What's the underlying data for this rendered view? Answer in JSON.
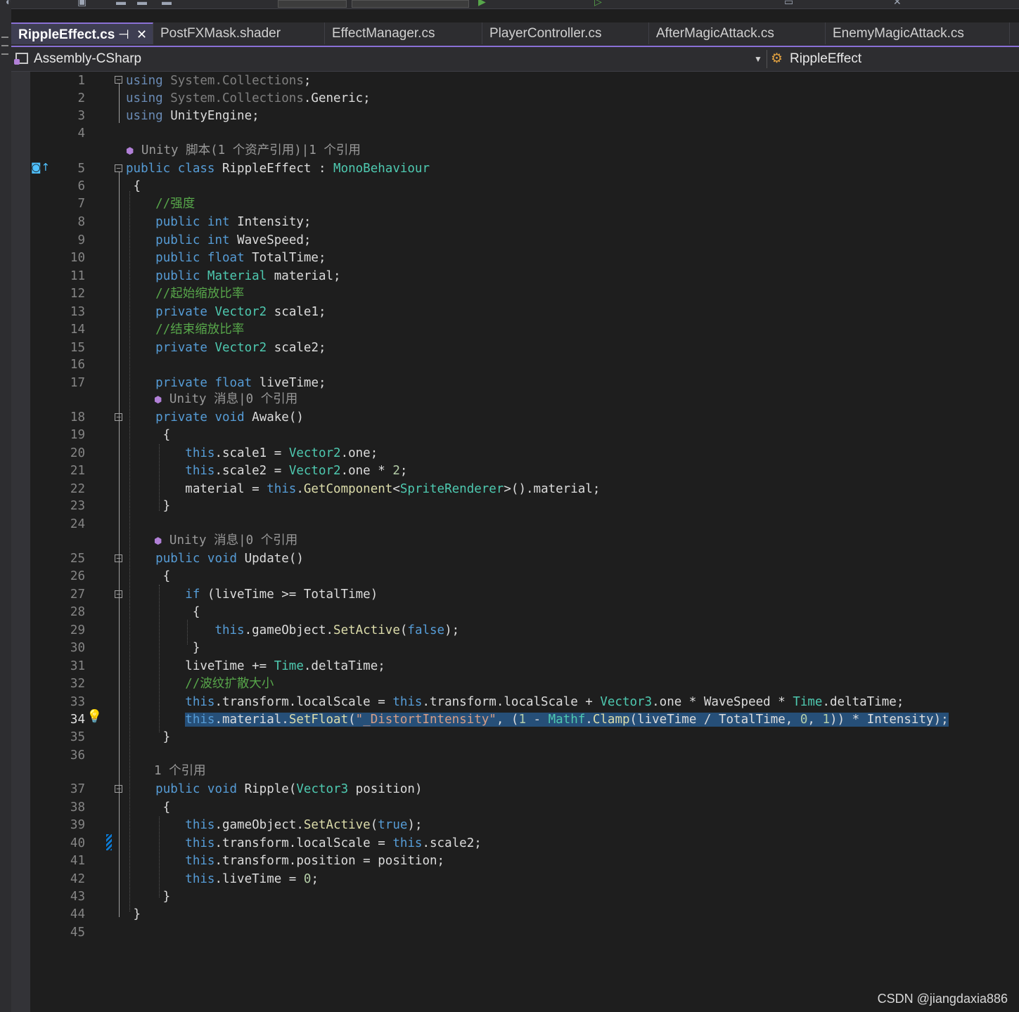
{
  "tabs": {
    "active": "RippleEffect.cs",
    "others": [
      "PostFXMask.shader",
      "EffectManager.cs",
      "PlayerController.cs",
      "AfterMagicAttack.cs",
      "EnemyMagicAttack.cs"
    ],
    "pin_icon": "pin-icon",
    "close_icon": "close-icon"
  },
  "navbar": {
    "project": "Assembly-CSharp",
    "class_name": "RippleEffect"
  },
  "code": {
    "lines": [
      {
        "n": "1",
        "t": "using System.Collections;"
      },
      {
        "n": "2",
        "t": "using System.Collections.Generic;"
      },
      {
        "n": "3",
        "t": "using UnityEngine;"
      },
      {
        "n": "4",
        "t": ""
      },
      {
        "n": "5",
        "t": "public class RippleEffect : MonoBehaviour"
      },
      {
        "n": "6",
        "t": " {"
      },
      {
        "n": "7",
        "t": "    //强度"
      },
      {
        "n": "8",
        "t": "    public int Intensity;"
      },
      {
        "n": "9",
        "t": "    public int WaveSpeed;"
      },
      {
        "n": "10",
        "t": "    public float TotalTime;"
      },
      {
        "n": "11",
        "t": "    public Material material;"
      },
      {
        "n": "12",
        "t": "    //起始缩放比率"
      },
      {
        "n": "13",
        "t": "    private Vector2 scale1;"
      },
      {
        "n": "14",
        "t": "    //结束缩放比率"
      },
      {
        "n": "15",
        "t": "    private Vector2 scale2;"
      },
      {
        "n": "16",
        "t": ""
      },
      {
        "n": "17",
        "t": "    private float liveTime;"
      },
      {
        "n": "18",
        "t": "    private void Awake()"
      },
      {
        "n": "19",
        "t": "     {"
      },
      {
        "n": "20",
        "t": "        this.scale1 = Vector2.one;"
      },
      {
        "n": "21",
        "t": "        this.scale2 = Vector2.one * 2;"
      },
      {
        "n": "22",
        "t": "        material = this.GetComponent<SpriteRenderer>().material;"
      },
      {
        "n": "23",
        "t": "     }"
      },
      {
        "n": "24",
        "t": ""
      },
      {
        "n": "25",
        "t": "    public void Update()"
      },
      {
        "n": "26",
        "t": "     {"
      },
      {
        "n": "27",
        "t": "        if (liveTime >= TotalTime)"
      },
      {
        "n": "28",
        "t": "         {"
      },
      {
        "n": "29",
        "t": "            this.gameObject.SetActive(false);"
      },
      {
        "n": "30",
        "t": "         }"
      },
      {
        "n": "31",
        "t": "        liveTime += Time.deltaTime;"
      },
      {
        "n": "32",
        "t": "        //波纹扩散大小"
      },
      {
        "n": "33",
        "t": "        this.transform.localScale = this.transform.localScale + Vector3.one * WaveSpeed * Time.deltaTime;"
      },
      {
        "n": "34",
        "t": "        this.material.SetFloat(\"_DistortIntensity\", (1 - Mathf.Clamp(liveTime / TotalTime, 0, 1)) * Intensity);"
      },
      {
        "n": "35",
        "t": "     }"
      },
      {
        "n": "36",
        "t": ""
      },
      {
        "n": "37",
        "t": "    public void Ripple(Vector3 position)"
      },
      {
        "n": "38",
        "t": "     {"
      },
      {
        "n": "39",
        "t": "        this.gameObject.SetActive(true);"
      },
      {
        "n": "40",
        "t": "        this.transform.localScale = this.scale2;"
      },
      {
        "n": "41",
        "t": "        this.transform.position = position;"
      },
      {
        "n": "42",
        "t": "        this.liveTime = 0;"
      },
      {
        "n": "43",
        "t": "     }"
      },
      {
        "n": "44",
        "t": " }"
      },
      {
        "n": "45",
        "t": ""
      }
    ],
    "codelens": {
      "class": "Unity 脚本(1 个资产引用)|1 个引用",
      "awake": "Unity 消息|0 个引用",
      "update": "Unity 消息|0 个引用",
      "ripple": "1 个引用"
    },
    "current_line": "34"
  },
  "watermark": "CSDN @jiangdaxia886",
  "colors": {
    "keyword": "#569cd6",
    "type": "#4ec9b0",
    "comment": "#57a64a",
    "string": "#d69d85",
    "number": "#b5cea8",
    "method": "#dcdcaa",
    "selection": "#264f78",
    "tab_accent": "#8a70d6"
  }
}
